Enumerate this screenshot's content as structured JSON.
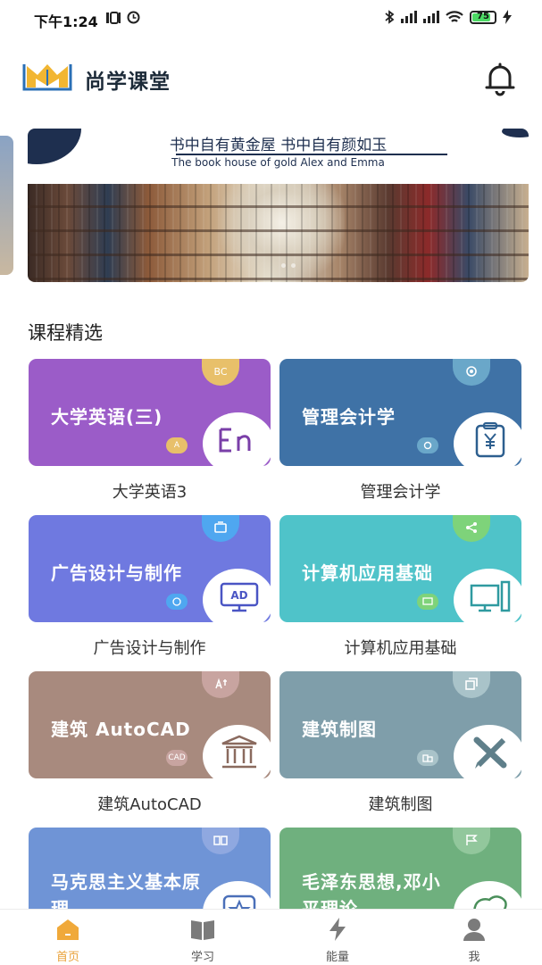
{
  "status_bar": {
    "time": "下午1:24",
    "battery": "75"
  },
  "header": {
    "app_title": "尚学课堂"
  },
  "banner": {
    "title": "书中自有黄金屋  书中自有颜如玉",
    "subtitle": "The book house of gold Alex and Emma"
  },
  "section": {
    "title": "课程精选"
  },
  "courses": [
    {
      "card_title": "大学英语(三)",
      "name": "大学英语3",
      "color": "#9b5cc8",
      "badge_top_text": "BC",
      "badge_top_color": "#e8c06a",
      "badge_bot_text": "A",
      "badge_bot_color": "#e8c06a",
      "icon": "en-letters-icon"
    },
    {
      "card_title": "管理会计学",
      "name": "管理会计学",
      "color": "#3f72a6",
      "badge_top_text": "",
      "badge_top_color": "#6aa7c9",
      "badge_bot_text": "",
      "badge_bot_color": "#6aa7c9",
      "icon": "yen-clipboard-icon"
    },
    {
      "card_title": "广告设计与制作",
      "name": "广告设计与制作",
      "color": "#6f79e0",
      "badge_top_text": "",
      "badge_top_color": "#4fa7f0",
      "badge_bot_text": "",
      "badge_bot_color": "#4fa7f0",
      "icon": "ad-monitor-icon"
    },
    {
      "card_title": "计算机应用基础",
      "name": "计算机应用基础",
      "color": "#4fc3c9",
      "badge_top_text": "",
      "badge_top_color": "#7ed37a",
      "badge_bot_text": "",
      "badge_bot_color": "#7ed37a",
      "icon": "computer-icon"
    },
    {
      "card_title": "建筑 AutoCAD",
      "name": "建筑AutoCAD",
      "color": "#a88a7e",
      "badge_top_text": "",
      "badge_top_color": "#c8a4a0",
      "badge_bot_text": "CAD",
      "badge_bot_color": "#c8a4a0",
      "icon": "building-columns-icon"
    },
    {
      "card_title": "建筑制图",
      "name": "建筑制图",
      "color": "#7f9eaa",
      "badge_top_text": "",
      "badge_top_color": "#a9c3c9",
      "badge_bot_text": "",
      "badge_bot_color": "#a9c3c9",
      "icon": "ruler-pencil-icon"
    },
    {
      "card_title": "马克思主义基本原理",
      "name": "",
      "color": "#6f94d6",
      "badge_top_text": "",
      "badge_top_color": "#8fa8e0",
      "badge_bot_text": "",
      "badge_bot_color": "#8fa8e0",
      "icon": "star-frame-icon"
    },
    {
      "card_title": "毛泽东思想,邓小平理论",
      "name": "",
      "color": "#6fb07e",
      "badge_top_text": "",
      "badge_top_color": "#92c79c",
      "badge_bot_text": "",
      "badge_bot_color": "#92c79c",
      "icon": "china-map-icon"
    }
  ],
  "bottom_nav": [
    {
      "label": "首页",
      "icon": "home-icon",
      "active": true
    },
    {
      "label": "学习",
      "icon": "book-icon",
      "active": false
    },
    {
      "label": "能量",
      "icon": "lightning-icon",
      "active": false
    },
    {
      "label": "我",
      "icon": "person-icon",
      "active": false
    }
  ],
  "colors": {
    "accent": "#e9a23a",
    "navy": "#1e2f4f"
  }
}
